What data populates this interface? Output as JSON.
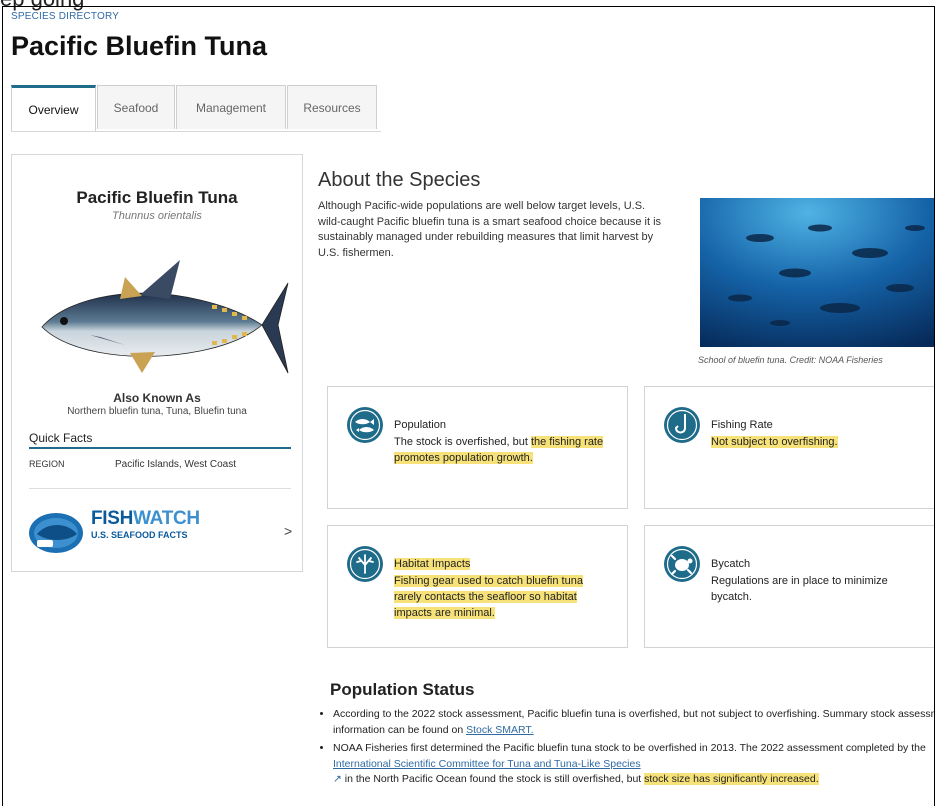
{
  "page": {
    "top_partial_text": "ep going",
    "breadcrumb": "SPECIES DIRECTORY",
    "title": "Pacific Bluefin Tuna"
  },
  "tabs": [
    {
      "label": "Overview",
      "active": true
    },
    {
      "label": "Seafood",
      "active": false
    },
    {
      "label": "Management",
      "active": false
    },
    {
      "label": "Resources",
      "active": false
    }
  ],
  "species_card": {
    "common_name": "Pacific Bluefin Tuna",
    "scientific_name": "Thunnus orientalis",
    "illustration_icon": "bluefin-tuna-illustration",
    "aka_heading": "Also Known As",
    "aka_value": "Northern bluefin tuna, Tuna, Bluefin tuna",
    "quick_facts_heading": "Quick Facts",
    "region_label": "REGION",
    "region_value": "Pacific Islands, West Coast",
    "fishwatch_title_a": "FISH",
    "fishwatch_title_b": "WATCH",
    "fishwatch_subtitle": "U.S. SEAFOOD FACTS",
    "fishwatch_arrow": ">"
  },
  "about": {
    "heading": "About the Species",
    "body": "Although Pacific-wide populations are well below target levels, U.S. wild-caught Pacific bluefin tuna is a smart seafood choice because it is sustainably managed under rebuilding measures that limit harvest by U.S. fishermen.",
    "photo_caption": "School of bluefin tuna. Credit: NOAA Fisheries"
  },
  "fact_cards": {
    "population": {
      "icon": "population-fish-icon",
      "title": "Population",
      "text_plain": "The stock is overfished, but ",
      "text_highlight": "the fishing rate promotes population growth."
    },
    "fishing_rate": {
      "icon": "fishing-hook-icon",
      "title": "Fishing Rate",
      "text_highlight": "Not subject to overfishing."
    },
    "habitat": {
      "icon": "coral-habitat-icon",
      "title": "Habitat Impacts",
      "text_highlight": "Fishing gear used to catch bluefin tuna rarely contacts the seafloor so habitat impacts are minimal."
    },
    "bycatch": {
      "icon": "turtle-bycatch-icon",
      "title": "Bycatch",
      "text_plain": "Regulations are in place to minimize bycatch."
    }
  },
  "population_status": {
    "heading": "Population Status",
    "item1_text": "According to the 2022 stock assessment, Pacific bluefin tuna is overfished, but not subject to overfishing. Summary stock assessment information can be found on ",
    "item1_link": "Stock SMART.",
    "item2_text_a": "NOAA Fisheries first determined the Pacific bluefin tuna stock to be overfished in 2013. The 2022 assessment completed by the ",
    "item2_link": "International Scientific Committee for Tuna and Tuna-Like Species",
    "item2_text_b": " in the North Pacific Ocean found the stock is still overfished, but ",
    "item2_highlight": "stock size has significantly increased."
  },
  "colors": {
    "accent": "#1f6b8a",
    "link": "#2f6aa3",
    "highlight": "#f7e27a",
    "fishwatch_blue": "#0a5a9c"
  }
}
